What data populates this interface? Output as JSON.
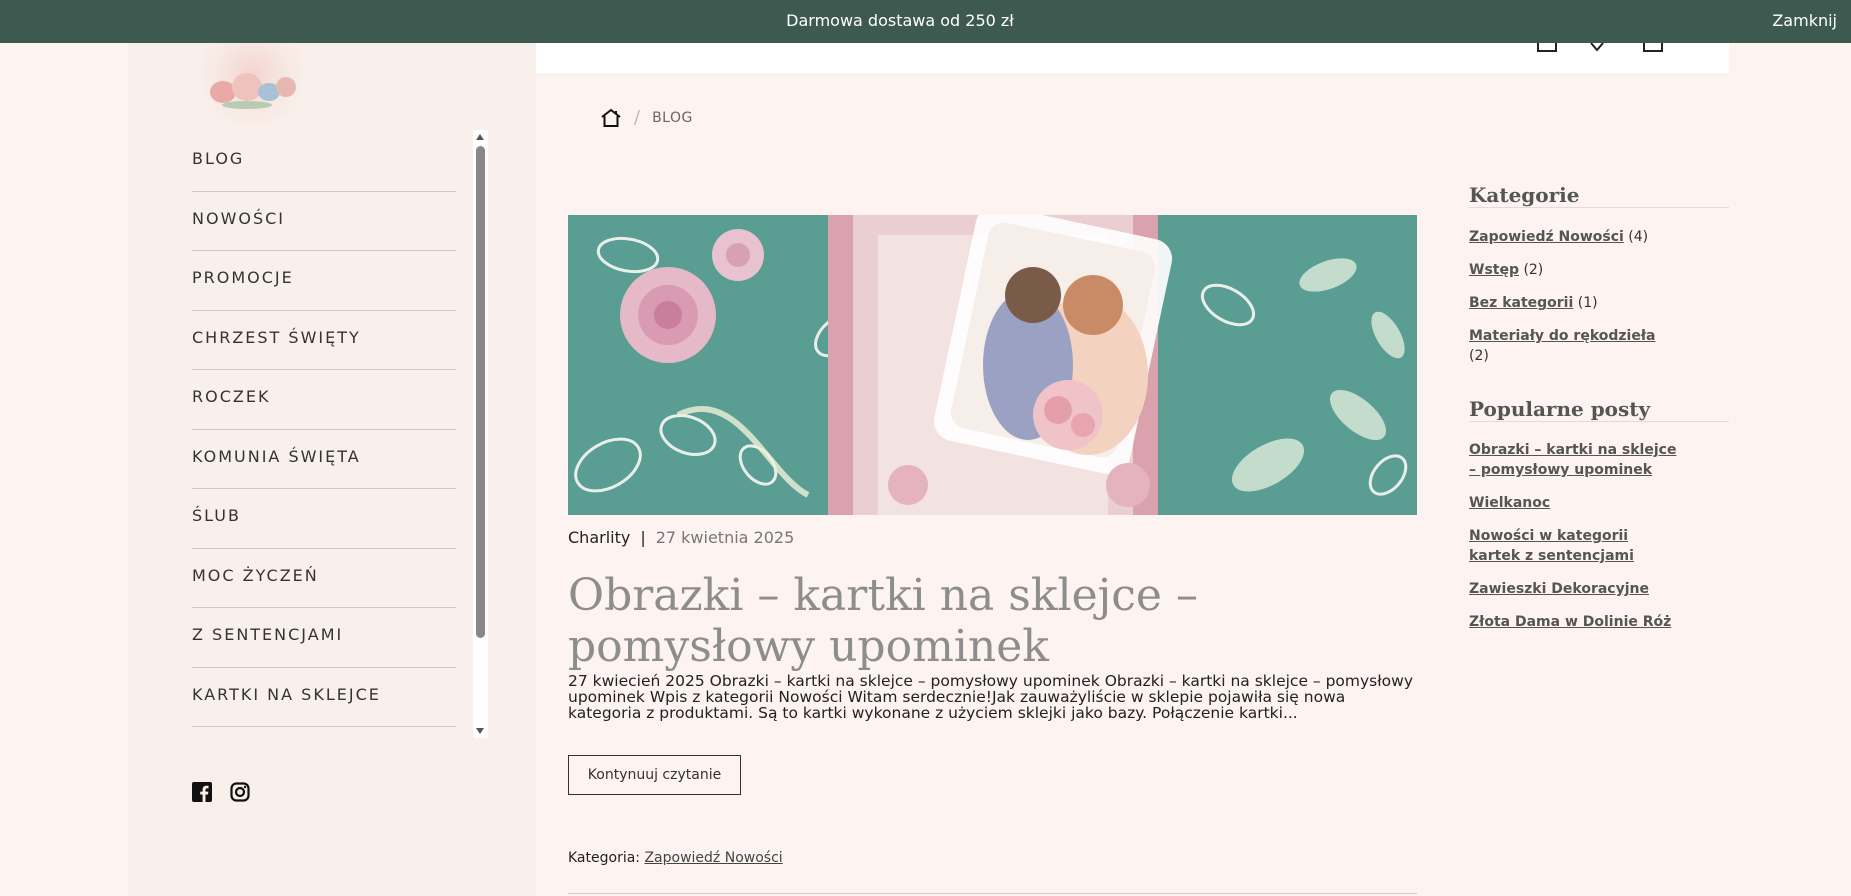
{
  "topbar": {
    "message": "Darmowa dostawa od 250 zł",
    "close_label": "Zamknij",
    "background": "#3e5a50"
  },
  "sidebar": {
    "nav_items": [
      {
        "label": "BLOG"
      },
      {
        "label": "NOWOŚCI"
      },
      {
        "label": "PROMOCJE"
      },
      {
        "label": "CHRZEST ŚWIĘTY"
      },
      {
        "label": "ROCZEK"
      },
      {
        "label": "KOMUNIA ŚWIĘTA"
      },
      {
        "label": "ŚLUB"
      },
      {
        "label": "MOC ŻYCZEŃ"
      },
      {
        "label": "Z SENTENCJAMI"
      },
      {
        "label": "KARTKI NA SKLEJCE"
      }
    ],
    "social": [
      "facebook-icon",
      "instagram-icon"
    ]
  },
  "breadcrumb": {
    "home_icon": "home-icon",
    "current": "BLOG"
  },
  "post": {
    "author": "Charlity",
    "separator": "|",
    "date": "27 kwietnia 2025",
    "title": "Obrazki – kartki na sklejce – pomysłowy upominek",
    "excerpt": "27 kwiecień 2025 Obrazki – kartki na sklejce – pomysłowy upominek Obrazki – kartki na sklejce – pomysłowy upominek Wpis z kategorii Nowości Witam serdecznie!Jak zauważyliście w sklepie pojawiła się nowa kategoria z produktami. Są to kartki wykonane z użyciem sklejki jako bazy. Połączenie kartki...",
    "button_label": "Kontynuuj czytanie",
    "category_prefix": "Kategoria:",
    "category_link": "Zapowiedź Nowości"
  },
  "widgets": {
    "categories": {
      "title": "Kategorie",
      "items": [
        {
          "label": "Zapowiedź Nowości",
          "count": "(4)"
        },
        {
          "label": "Wstęp",
          "count": "(2)"
        },
        {
          "label": "Bez kategorii",
          "count": "(1)"
        },
        {
          "label": "Materiały do rękodzieła",
          "count": "(2)"
        }
      ]
    },
    "popular": {
      "title": "Popularne posty",
      "items": [
        {
          "label": "Obrazki – kartki na sklejce – pomysłowy upominek"
        },
        {
          "label": "Wielkanoc"
        },
        {
          "label": "Nowości w kategorii kartek z sentencjami"
        },
        {
          "label": "Zawieszki Dekoracyjne"
        },
        {
          "label": "Złota Dama w Dolinie Róż"
        }
      ]
    }
  }
}
